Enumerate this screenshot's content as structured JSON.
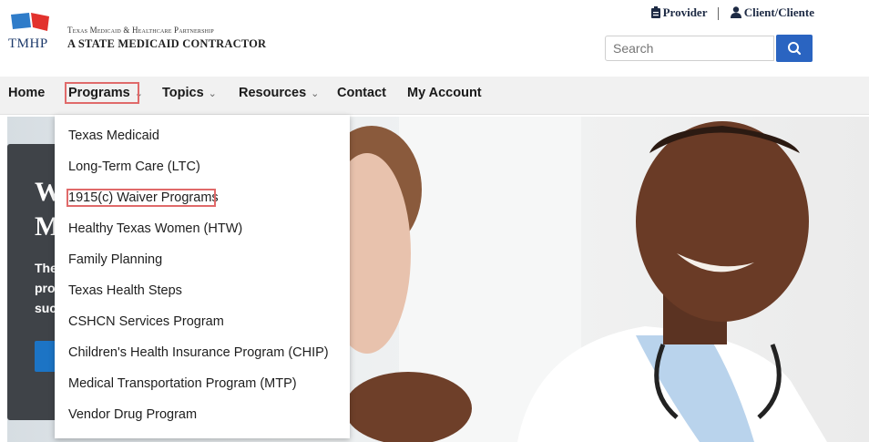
{
  "header": {
    "logo_text": "TMHP",
    "partnership_line": "Texas Medicaid & Healthcare Partnership",
    "contractor_line": "A STATE MEDICAID CONTRACTOR",
    "top_links": {
      "provider": "Provider",
      "client": "Client/Cliente"
    },
    "search": {
      "placeholder": "Search"
    }
  },
  "nav": {
    "items": [
      {
        "label": "Home"
      },
      {
        "label": "Programs"
      },
      {
        "label": "Topics"
      },
      {
        "label": "Resources"
      },
      {
        "label": "Contact"
      },
      {
        "label": "My Account"
      }
    ]
  },
  "hero": {
    "heading_line1": "W",
    "heading_line2": "M",
    "text_line1": "The",
    "text_line2": "pro",
    "text_line3": "suc"
  },
  "dropdown": {
    "items": [
      "Texas Medicaid",
      "Long-Term Care (LTC)",
      "1915(c) Waiver Programs",
      "Healthy Texas Women (HTW)",
      "Family Planning",
      "Texas Health Steps",
      "CSHCN Services Program",
      "Children's Health Insurance Program (CHIP)",
      "Medical Transportation Program (MTP)",
      "Vendor Drug Program"
    ]
  },
  "colors": {
    "brand_blue": "#2a64c1",
    "logo_red": "#e2322d",
    "highlight_red": "#e06a6a",
    "hero_card": "#3f4348"
  }
}
